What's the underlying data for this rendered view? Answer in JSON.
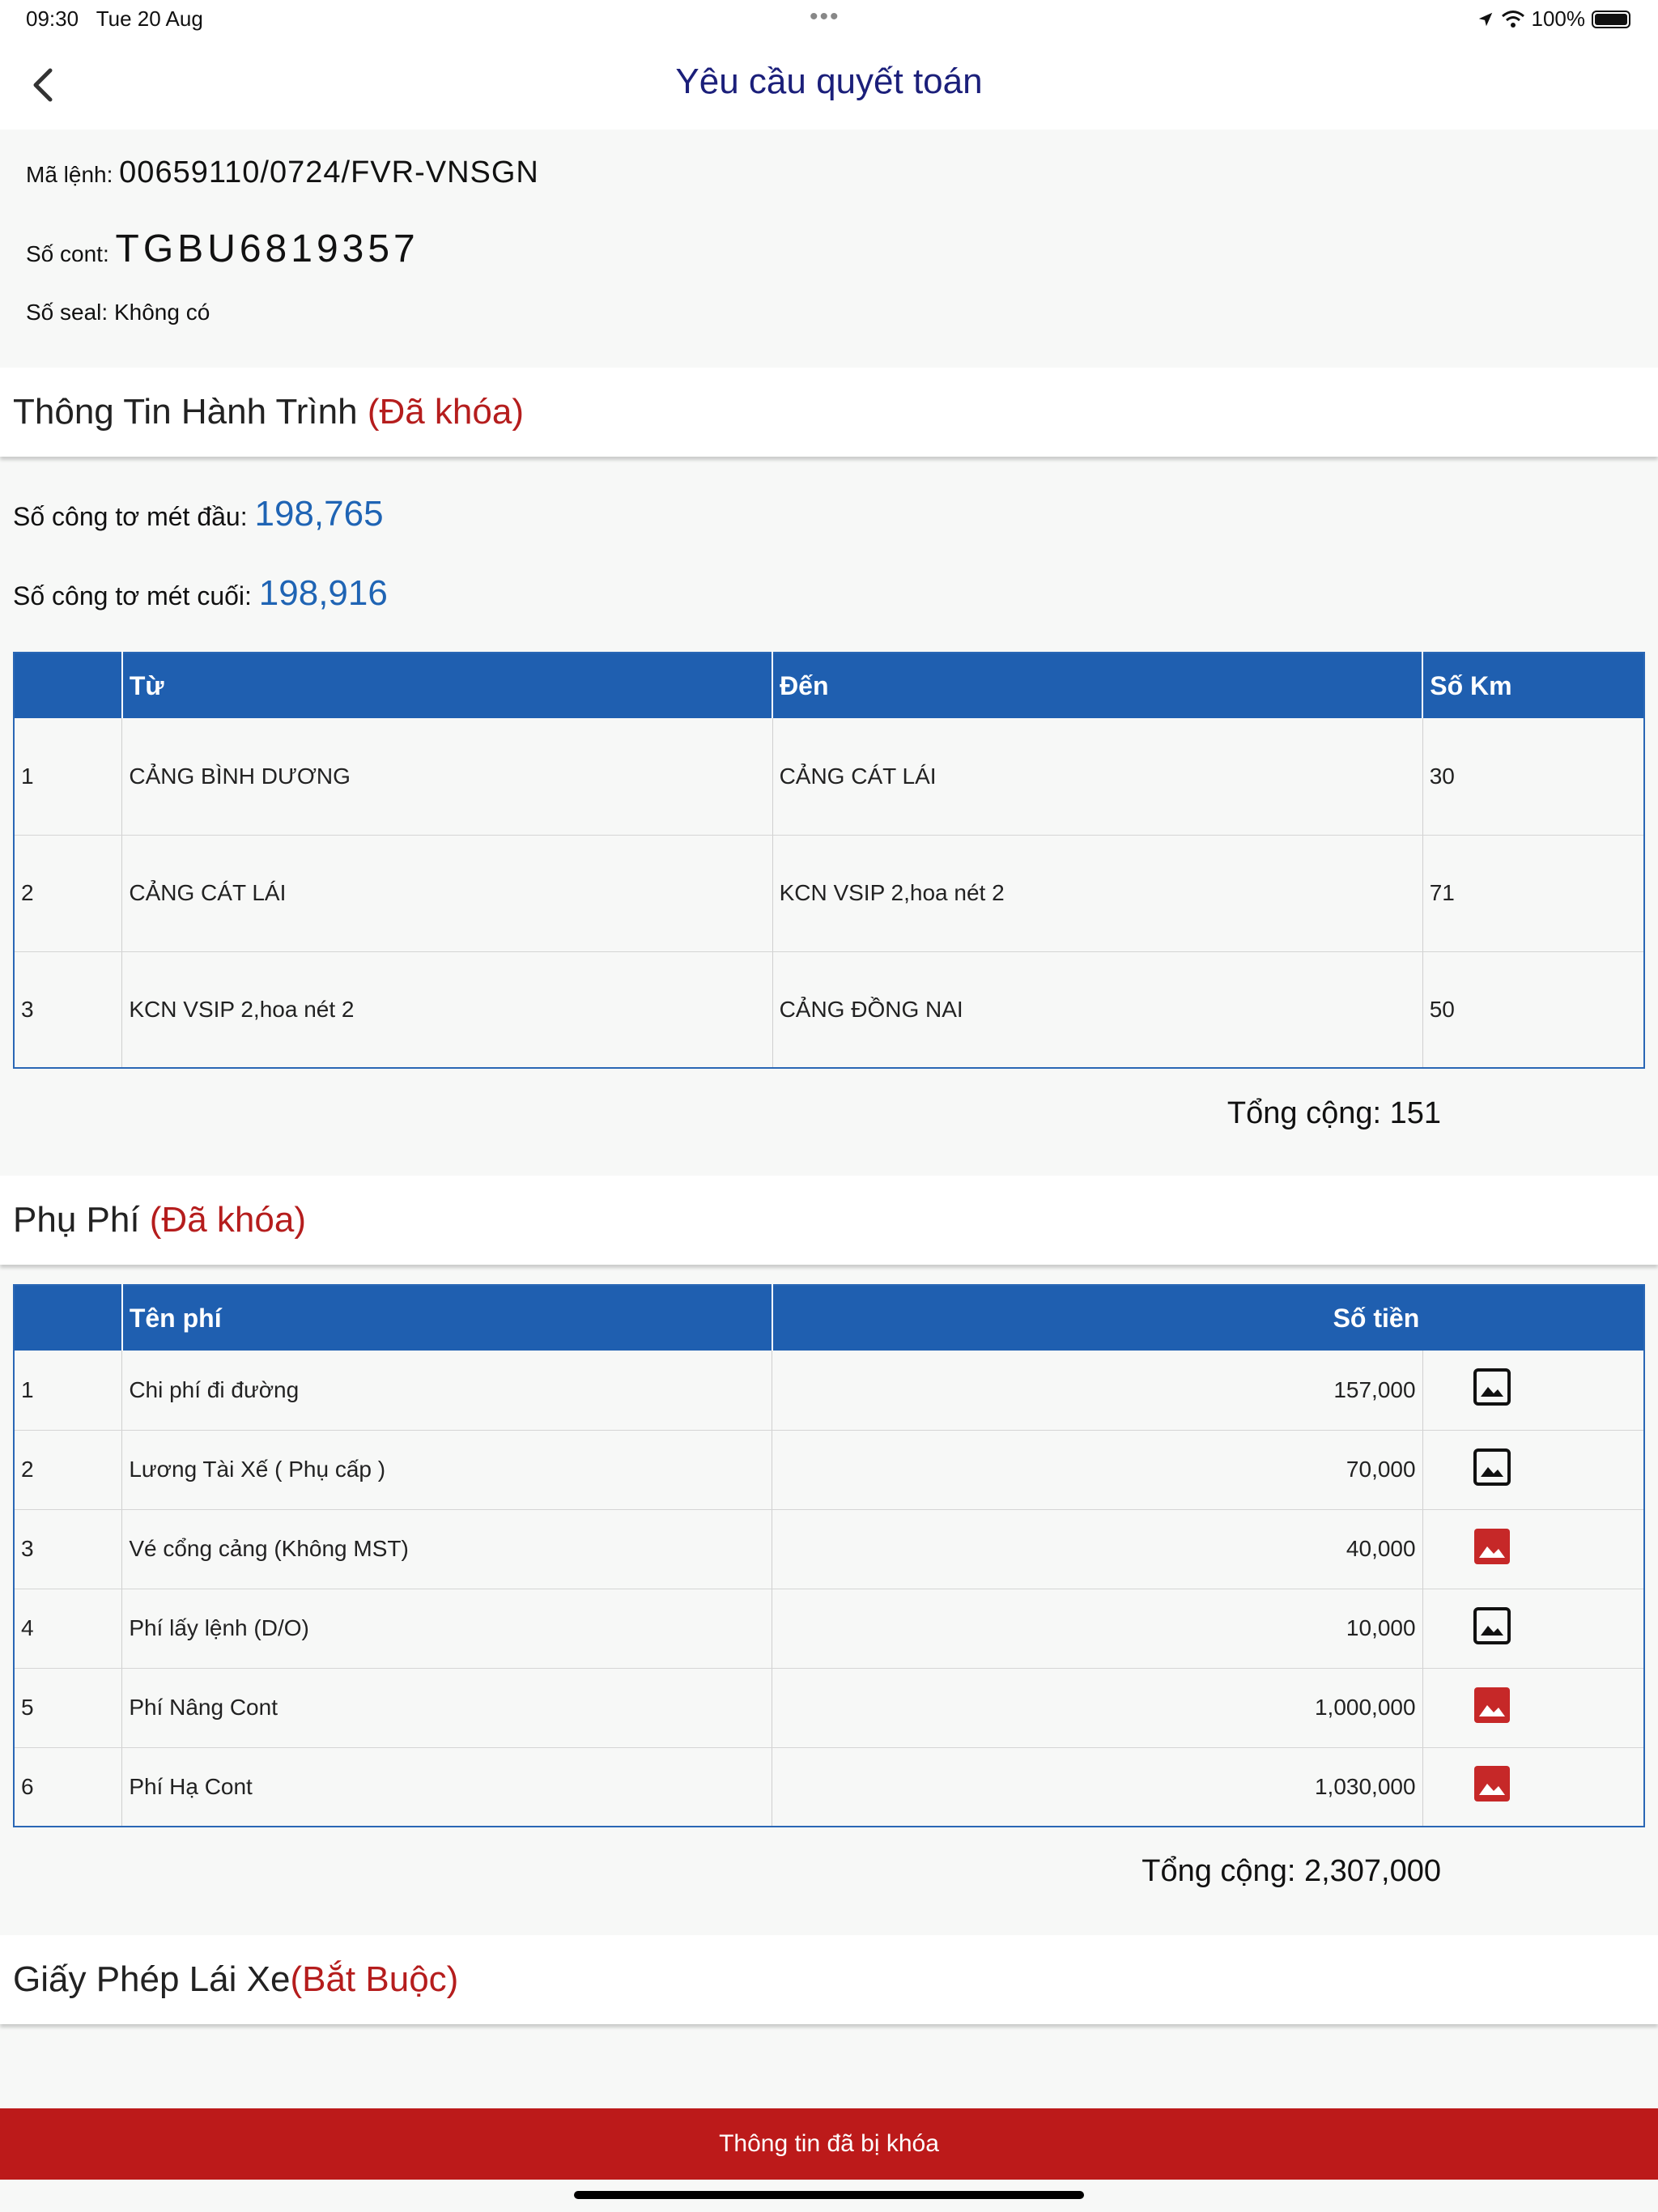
{
  "status_bar": {
    "time": "09:30",
    "date": "Tue 20 Aug",
    "battery": "100%"
  },
  "nav": {
    "title": "Yêu cầu quyết toán",
    "back_icon": "chevron-left-icon"
  },
  "order": {
    "code_label": "Mã lệnh: ",
    "code_value": "00659110/0724/FVR-VNSGN",
    "cont_label": "Số cont: ",
    "cont_value": "TGBU6819357",
    "seal_label": "Số seal: ",
    "seal_value": "Không có"
  },
  "journey": {
    "title": "Thông Tin Hành Trình ",
    "status": "(Đã khóa)",
    "odo_start_label": "Số công tơ mét đầu: ",
    "odo_start_value": "198,765",
    "odo_end_label": "Số công tơ mét cuối: ",
    "odo_end_value": "198,916",
    "headers": [
      "",
      "Từ",
      "Đến",
      "Số Km"
    ],
    "rows": [
      {
        "no": "1",
        "from": "CẢNG BÌNH DƯƠNG",
        "to": "CẢNG CÁT LÁI",
        "km": "30"
      },
      {
        "no": "2",
        "from": "CẢNG CÁT LÁI",
        "to": "KCN VSIP 2,hoa nét 2",
        "km": "71"
      },
      {
        "no": "3",
        "from": "KCN VSIP 2,hoa nét 2",
        "to": "CẢNG ĐỒNG NAI",
        "km": "50"
      }
    ],
    "total": "Tổng cộng: 151"
  },
  "fees": {
    "title": "Phụ Phí ",
    "status": "(Đã khóa)",
    "headers": [
      "",
      "Tên phí",
      "Số tiền"
    ],
    "rows": [
      {
        "no": "1",
        "name": "Chi phí đi đường",
        "amount": "157,000",
        "icon": "image-outline-icon",
        "icon_color": "#111111"
      },
      {
        "no": "2",
        "name": "Lương Tài Xế ( Phụ cấp )",
        "amount": "70,000",
        "icon": "image-outline-icon",
        "icon_color": "#111111"
      },
      {
        "no": "3",
        "name": "Vé cổng cảng (Không MST)",
        "amount": "40,000",
        "icon": "image-filled-icon",
        "icon_color": "#c62828"
      },
      {
        "no": "4",
        "name": "Phí lấy lệnh (D/O)",
        "amount": "10,000",
        "icon": "image-outline-icon",
        "icon_color": "#111111"
      },
      {
        "no": "5",
        "name": "Phí Nâng Cont",
        "amount": "1,000,000",
        "icon": "image-filled-icon",
        "icon_color": "#c62828"
      },
      {
        "no": "6",
        "name": "Phí Hạ Cont",
        "amount": "1,030,000",
        "icon": "image-filled-icon",
        "icon_color": "#c62828"
      }
    ],
    "total": "Tổng cộng: 2,307,000"
  },
  "license": {
    "title": "Giấy Phép Lái Xe",
    "status": "(Bắt Buộc)"
  },
  "footer": {
    "locked_label": "Thông tin đã bị khóa"
  },
  "colors": {
    "accent": "#1f5fb0",
    "locked": "#b51d1d",
    "bar": "#bc1a1a",
    "title": "#1b1f7a"
  }
}
